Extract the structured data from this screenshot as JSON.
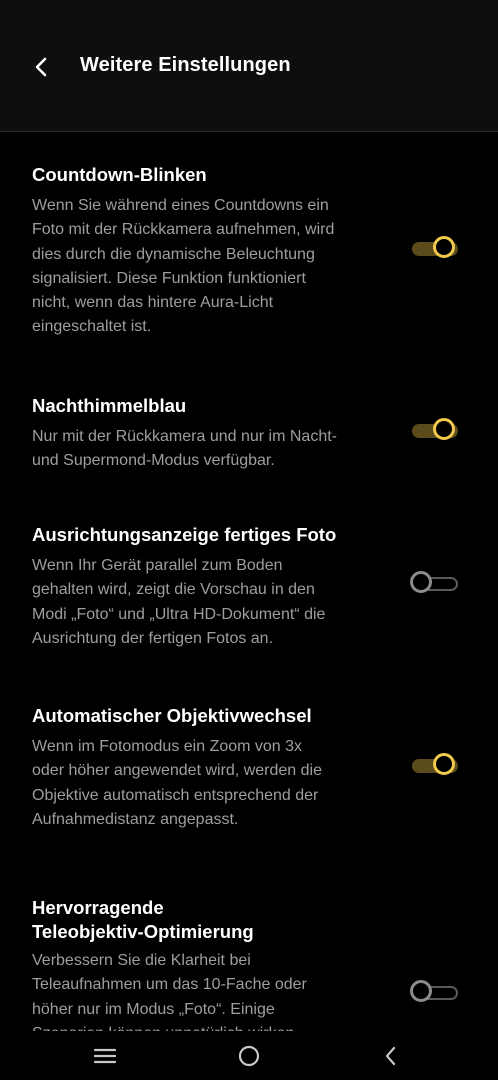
{
  "header": {
    "title": "Weitere Einstellungen",
    "back_icon": "chevron-left-icon"
  },
  "settings": [
    {
      "title": "Countdown-Blinken",
      "description": "Wenn Sie während eines Countdowns ein\nFoto mit der Rückkamera aufnehmen, wird\ndies durch die dynamische Beleuchtung\nsignalisiert. Diese Funktion funktioniert\nnicht, wenn das hintere Aura-Licht\neingeschaltet ist.",
      "enabled": true
    },
    {
      "title": "Nachthimmelblau",
      "description": "Nur mit der Rückkamera und nur im Nacht-\nund Supermond-Modus verfügbar.",
      "enabled": true
    },
    {
      "title": "Ausrichtungsanzeige fertiges Foto",
      "description": "Wenn Ihr Gerät parallel zum Boden\ngehalten wird, zeigt die Vorschau in den\nModi „Foto“ und „Ultra HD-Dokument“ die\nAusrichtung der fertigen Fotos an.",
      "enabled": false
    },
    {
      "title": "Automatischer Objektivwechsel",
      "description": "Wenn im Fotomodus ein Zoom von 3x\noder höher angewendet wird, werden die\nObjektive automatisch entsprechend der\nAufnahmedistanz angepasst.",
      "enabled": true
    },
    {
      "title": "Hervorragende\nTeleobjektiv-Optimierung",
      "description": "Verbessern Sie die Klarheit bei\nTeleaufnahmen um das 10-Fache oder\nhöher nur im Modus „Foto“. Einige\nSzenarien können unnatürlich wirken.",
      "enabled": false
    }
  ],
  "navbar": {
    "icons": [
      "menu-icon",
      "home-icon",
      "back-icon"
    ]
  },
  "colors": {
    "background": "#000000",
    "header_bg": "#0e0e0e",
    "accent": "#f2c94c",
    "track_on": "#5b4b1c",
    "description": "#9e9e9e"
  }
}
